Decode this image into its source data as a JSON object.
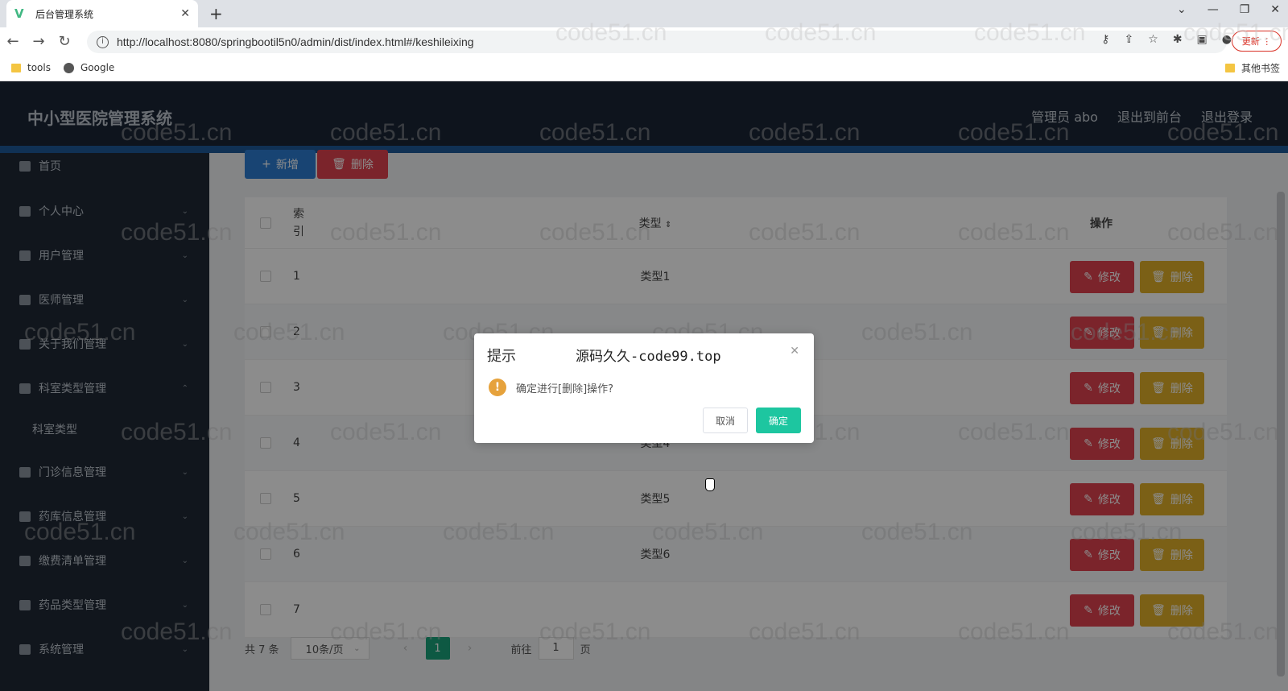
{
  "browser": {
    "tab_title": "后台管理系统",
    "favicon": "V",
    "url": "http://localhost:8080/springbootil5n0/admin/dist/index.html#/keshileixing",
    "update_label": "更新",
    "bookmarks": [
      {
        "label": "tools"
      },
      {
        "label": "Google"
      }
    ],
    "other_bookmarks": "其他书签"
  },
  "header": {
    "title": "中小型医院管理系统",
    "user": "管理员 abo",
    "to_front": "退出到前台",
    "logout": "退出登录"
  },
  "sidebar": {
    "items": [
      {
        "label": "首页",
        "icon": "home-icon"
      },
      {
        "label": "个人中心",
        "icon": "user-icon"
      },
      {
        "label": "用户管理",
        "icon": "users-icon"
      },
      {
        "label": "医师管理",
        "icon": "doctor-icon"
      },
      {
        "label": "关于我们管理",
        "icon": "info-icon"
      },
      {
        "label": "科室类型管理",
        "icon": "list-icon"
      },
      {
        "label": "科室类型",
        "icon": ""
      },
      {
        "label": "门诊信息管理",
        "icon": "clinic-icon"
      },
      {
        "label": "药库信息管理",
        "icon": "pharmacy-icon"
      },
      {
        "label": "缴费清单管理",
        "icon": "payment-icon"
      },
      {
        "label": "药品类型管理",
        "icon": "medicine-icon"
      },
      {
        "label": "系统管理",
        "icon": "system-icon"
      }
    ]
  },
  "toolbar": {
    "add_label": "新增",
    "delete_label": "删除"
  },
  "table": {
    "headers": {
      "index_line1": "索",
      "index_line2": "引",
      "type": "类型",
      "op": "操作"
    },
    "rows": [
      {
        "index": "1",
        "type": "类型1"
      },
      {
        "index": "2",
        "type": ""
      },
      {
        "index": "3",
        "type": ""
      },
      {
        "index": "4",
        "type": "类型4"
      },
      {
        "index": "5",
        "type": "类型5"
      },
      {
        "index": "6",
        "type": "类型6"
      },
      {
        "index": "7",
        "type": ""
      }
    ],
    "edit_label": "修改",
    "remove_label": "删除"
  },
  "pager": {
    "total": "共 7 条",
    "page_size": "10条/页",
    "current": "1",
    "goto_prefix": "前往",
    "goto_value": "1",
    "goto_suffix": "页"
  },
  "dialog": {
    "title": "提示",
    "watermark": "源码久久-code99.top",
    "message": "确定进行[删除]操作?",
    "cancel": "取消",
    "confirm": "确定"
  },
  "watermark_text": "code51.cn",
  "colors": {
    "header_bg": "#1a2535",
    "sidebar_bg": "#1f2935",
    "primary": "#2d7dd2",
    "danger": "#e0434f",
    "warning": "#e0b028",
    "success": "#1dc6a0"
  }
}
